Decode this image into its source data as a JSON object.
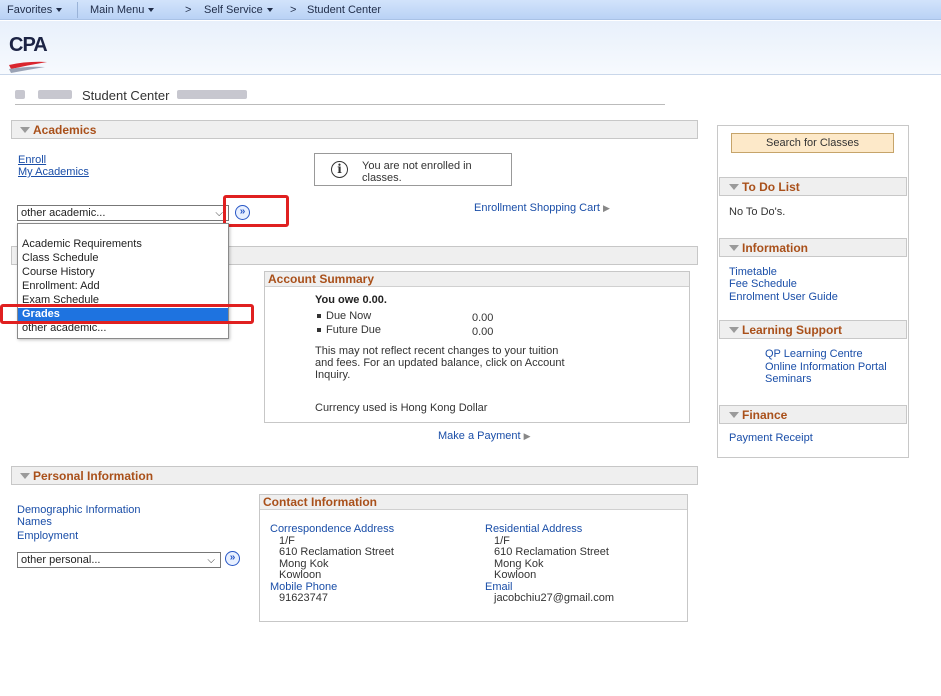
{
  "topnav": {
    "favorites": "Favorites",
    "main_menu": "Main Menu",
    "arrow1": ">",
    "self_service": "Self Service",
    "arrow2": ">",
    "student_center": "Student Center"
  },
  "header": {
    "logo_text": "CPA"
  },
  "page": {
    "title": "Student Center"
  },
  "academics": {
    "header": "Academics",
    "links": [
      "Enroll",
      "My Academics"
    ],
    "info_icon": "i",
    "info_message": "You are not enrolled in classes.",
    "select_value": "other academic...",
    "go_icon": "»",
    "shopping_cart": "Enrollment Shopping Cart",
    "dropdown_options": [
      "Academic Requirements",
      "Class Schedule",
      "Course History",
      "Enrollment: Add",
      "Exam Schedule",
      "Grades",
      "other academic..."
    ],
    "selected_option": "Grades"
  },
  "finances": {
    "account_summary_title": "Account Summary",
    "you_owe": "You owe 0.00.",
    "due_now_label": "Due Now",
    "due_now_value": "0.00",
    "future_due_label": "Future Due",
    "future_due_value": "0.00",
    "note_line1": "This may not reflect recent changes to your tuition",
    "note_line2": "and fees.  For an updated balance, click on Account",
    "note_line3": "Inquiry.",
    "currency": "Currency used is Hong Kong Dollar",
    "make_payment": "Make a Payment"
  },
  "personal": {
    "header": "Personal Information",
    "links": [
      "Demographic Information",
      "Names",
      "Employment"
    ],
    "select_value": "other personal...",
    "go_icon": "»",
    "contact_title": "Contact Information",
    "correspondence_label": "Correspondence Address",
    "correspondence_lines": [
      "1/F",
      "610 Reclamation Street",
      "Mong Kok",
      "Kowloon"
    ],
    "mobile_label": "Mobile Phone",
    "mobile_value": "91623747",
    "residential_label": "Residential Address",
    "residential_lines": [
      "1/F",
      "610 Reclamation Street",
      "Mong Kok",
      "Kowloon"
    ],
    "email_label": "Email",
    "email_value": "jacobchiu27@gmail.com"
  },
  "sidebar": {
    "search_button": "Search for Classes",
    "todo_header": "To Do List",
    "todo_text": "No To Do's.",
    "info_header": "Information",
    "info_links": [
      "Timetable",
      "Fee Schedule",
      "Enrolment User Guide"
    ],
    "learning_header": "Learning Support",
    "learning_links": [
      "QP Learning Centre",
      "Online Information Portal",
      "Seminars"
    ],
    "finance_header": "Finance",
    "finance_links": [
      "Payment Receipt"
    ]
  }
}
